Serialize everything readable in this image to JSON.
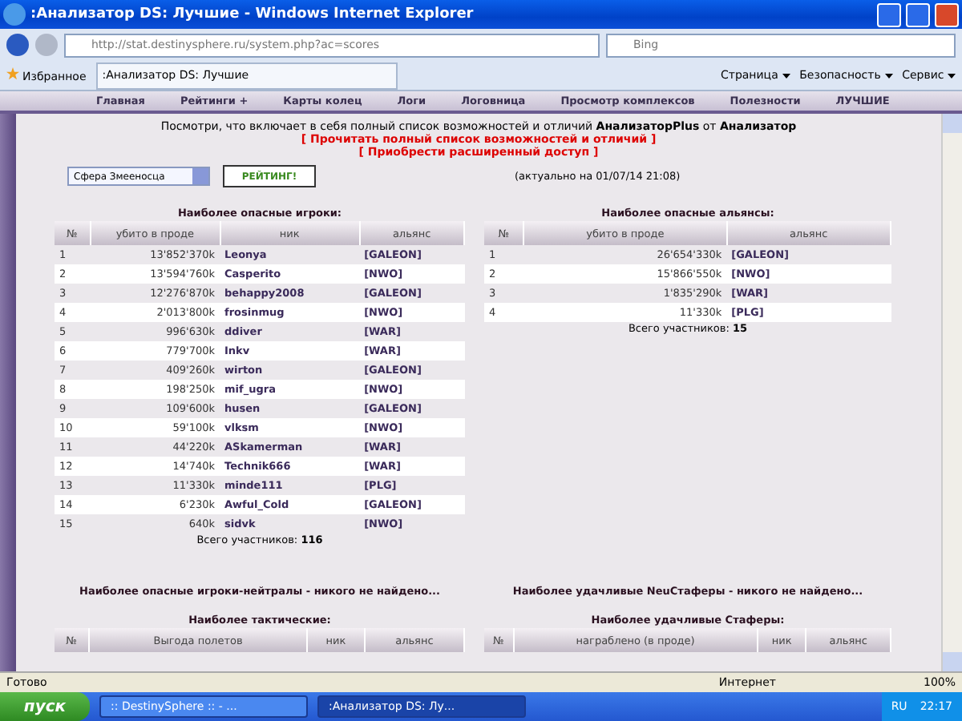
{
  "window": {
    "title": ":Анализатор DS: Лучшие - Windows Internet Explorer"
  },
  "address_bar": {
    "url": "http://stat.destinysphere.ru/system.php?ac=scores",
    "search_placeholder": "Bing"
  },
  "favorites_bar": {
    "favorites": "Избранное",
    "tab_title": ":Анализатор DS: Лучшие",
    "commands": [
      "Страница",
      "Безопасность",
      "Сервис"
    ]
  },
  "site_nav": [
    "Главная",
    "Рейтинги +",
    "Карты колец",
    "Логи",
    "Логовница",
    "Просмотр комплексов",
    "Полезности",
    "ЛУЧШИЕ"
  ],
  "intro": {
    "text": "Посмотри, что включает в себя полный список возможностей и отличий **АнализаторPlus** от **Анализатор**",
    "links": [
      "[ Прочитать полный список возможностей и отличий ]",
      "[ Приобрести расширенный доступ ]"
    ]
  },
  "controls": {
    "sphere_select": "Сфера Змееносца",
    "rating_button": "РЕЙТИНГ!",
    "updated": "(актуально на 01/07/14 21:08)"
  },
  "players": {
    "title": "Наиболее опасные игроки:",
    "columns": [
      "№",
      "убито в проде",
      "ник",
      "альянс"
    ],
    "rows": [
      [
        "1",
        "13'852'370k",
        "Leonya",
        "[GALEON]"
      ],
      [
        "2",
        "13'594'760k",
        "Casperito",
        "[NWO]"
      ],
      [
        "3",
        "12'276'870k",
        "behappy2008",
        "[GALEON]"
      ],
      [
        "4",
        "2'013'800k",
        "frosinmug",
        "[NWO]"
      ],
      [
        "5",
        "996'630k",
        "ddiver",
        "[WAR]"
      ],
      [
        "6",
        "779'700k",
        "Inkv",
        "[WAR]"
      ],
      [
        "7",
        "409'260k",
        "wirton",
        "[GALEON]"
      ],
      [
        "8",
        "198'250k",
        "mif_ugra",
        "[NWO]"
      ],
      [
        "9",
        "109'600k",
        "husen",
        "[GALEON]"
      ],
      [
        "10",
        "59'100k",
        "vlksm",
        "[NWO]"
      ],
      [
        "11",
        "44'220k",
        "ASkamerman",
        "[WAR]"
      ],
      [
        "12",
        "14'740k",
        "Technik666",
        "[WAR]"
      ],
      [
        "13",
        "11'330k",
        "minde111",
        "[PLG]"
      ],
      [
        "14",
        "6'230k",
        "Awful_Cold",
        "[GALEON]"
      ],
      [
        "15",
        "640k",
        "sidvk",
        "[NWO]"
      ]
    ],
    "total_label": "Всего участников:",
    "total": "116"
  },
  "alliances": {
    "title": "Наиболее опасные альянсы:",
    "columns": [
      "№",
      "убито в проде",
      "альянс"
    ],
    "rows": [
      [
        "1",
        "26'654'330k",
        "[GALEON]"
      ],
      [
        "2",
        "15'866'550k",
        "[NWO]"
      ],
      [
        "3",
        "1'835'290k",
        "[WAR]"
      ],
      [
        "4",
        "11'330k",
        "[PLG]"
      ]
    ],
    "total_label": "Всего участников:",
    "total": "15"
  },
  "neutrals": "Наиболее опасные игроки-нейтралы - никого не найдено...",
  "neustaffers": "Наиболее удачливые NeuСтаферы - никого не найдено...",
  "tactical": {
    "title": "Наиболее тактические:",
    "columns": [
      "№",
      "Выгода полетов",
      "ник",
      "альянс"
    ]
  },
  "staffers": {
    "title": "Наиболее удачливые Стаферы:",
    "columns": [
      "№",
      "награблено (в проде)",
      "ник",
      "альянс"
    ]
  },
  "status_bar": {
    "text": "Готово",
    "zone": "Интернет",
    "zoom": "100%"
  },
  "taskbar": {
    "start": "пуск",
    "windows": [
      {
        "title": ":: DestinySphere :: - ...",
        "selected": false
      },
      {
        "title": ":Анализатор DS: Лу...",
        "selected": true
      }
    ],
    "language": "RU",
    "clock": "22:17"
  }
}
